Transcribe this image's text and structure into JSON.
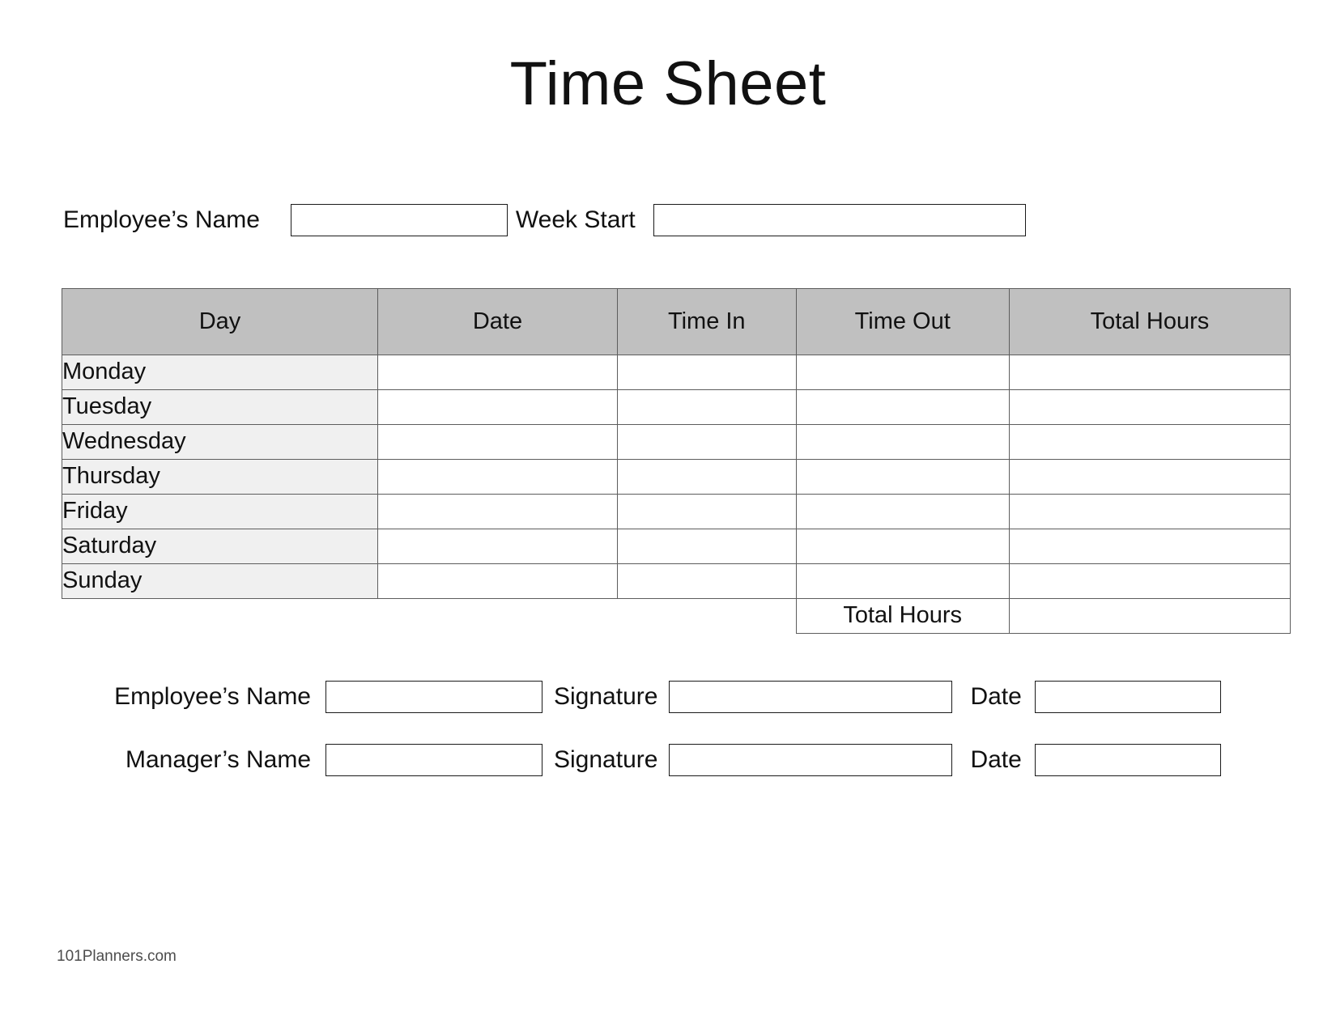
{
  "document": {
    "title": "Time Sheet"
  },
  "header_fields": {
    "employee_name_label": "Employee’s Name",
    "employee_name_value": "",
    "week_start_label": "Week Start",
    "week_start_value": ""
  },
  "table": {
    "columns": [
      "Day",
      "Date",
      "Time In",
      "Time Out",
      "Total Hours"
    ],
    "rows": [
      {
        "day": "Monday",
        "date": "",
        "time_in": "",
        "time_out": "",
        "total_hours": ""
      },
      {
        "day": "Tuesday",
        "date": "",
        "time_in": "",
        "time_out": "",
        "total_hours": ""
      },
      {
        "day": "Wednesday",
        "date": "",
        "time_in": "",
        "time_out": "",
        "total_hours": ""
      },
      {
        "day": "Thursday",
        "date": "",
        "time_in": "",
        "time_out": "",
        "total_hours": ""
      },
      {
        "day": "Friday",
        "date": "",
        "time_in": "",
        "time_out": "",
        "total_hours": ""
      },
      {
        "day": "Saturday",
        "date": "",
        "time_in": "",
        "time_out": "",
        "total_hours": ""
      },
      {
        "day": "Sunday",
        "date": "",
        "time_in": "",
        "time_out": "",
        "total_hours": ""
      }
    ],
    "summary": {
      "label": "Total Hours",
      "value": ""
    }
  },
  "signatures": {
    "employee": {
      "name_label": "Employee’s Name",
      "name_value": "",
      "signature_label": "Signature",
      "signature_value": "",
      "date_label": "Date",
      "date_value": ""
    },
    "manager": {
      "name_label": "Manager’s Name",
      "name_value": "",
      "signature_label": "Signature",
      "signature_value": "",
      "date_label": "Date",
      "date_value": ""
    }
  },
  "footer": {
    "credit": "101Planners.com"
  },
  "colors": {
    "header_fill": "#c0c0c0",
    "day_cell_fill": "#f0f0f0",
    "grid_line": "#5d5d5d",
    "box_border": "#1a1a1a",
    "text": "#111111",
    "footer_text": "#4d4d4d"
  }
}
